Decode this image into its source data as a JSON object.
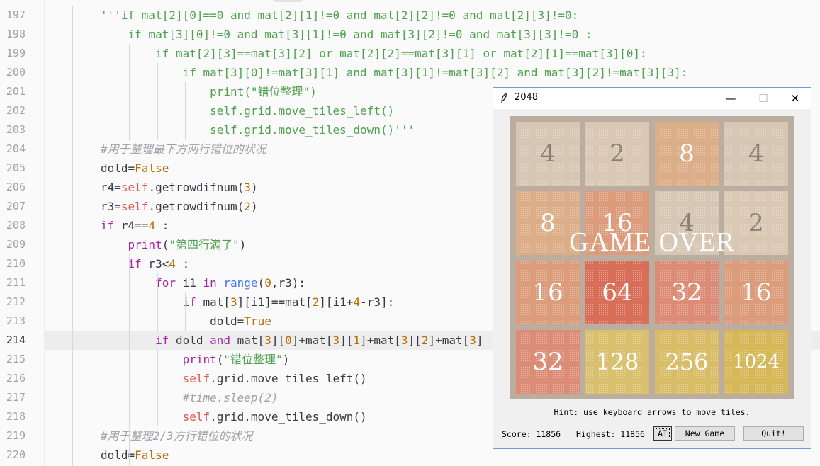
{
  "editor": {
    "current_line": "214",
    "lines": [
      {
        "no": "197",
        "tokens": [
          {
            "t": "'''if mat[2][0]==0 and mat[2][1]!=0 and mat[2][2]!=0 and mat[2][3]!=0:",
            "c": "s"
          }
        ]
      },
      {
        "no": "198",
        "tokens": [
          {
            "t": "    if mat[3][0]!=0 and mat[3][1]!=0 and mat[3][2]!=0 and mat[3][3]!=0 :",
            "c": "s"
          }
        ]
      },
      {
        "no": "199",
        "tokens": [
          {
            "t": "        if mat[2][3]==mat[3][2] or mat[2][2]==mat[3][1] or mat[2][1]==mat[3][0]:",
            "c": "s"
          }
        ]
      },
      {
        "no": "200",
        "tokens": [
          {
            "t": "            if mat[3][0]!=mat[3][1] and mat[3][1]!=mat[3][2] and mat[3][2]!=mat[3][3]:",
            "c": "s"
          }
        ]
      },
      {
        "no": "201",
        "tokens": [
          {
            "t": "                print(\"错位整理\")",
            "c": "s"
          }
        ]
      },
      {
        "no": "202",
        "tokens": [
          {
            "t": "                self.grid.move_tiles_left()",
            "c": "s"
          }
        ]
      },
      {
        "no": "203",
        "tokens": [
          {
            "t": "                self.grid.move_tiles_down()'''",
            "c": "s"
          }
        ]
      },
      {
        "no": "204",
        "tokens": [
          {
            "t": "#用于整理最下方两行错位的状况",
            "c": "c"
          }
        ]
      },
      {
        "no": "205",
        "tokens": [
          {
            "t": "dold=",
            "c": "p"
          },
          {
            "t": "False",
            "c": "n"
          }
        ]
      },
      {
        "no": "206",
        "tokens": [
          {
            "t": "r4=",
            "c": "p"
          },
          {
            "t": "self",
            "c": "sf"
          },
          {
            "t": ".getrowdifnum(",
            "c": "p"
          },
          {
            "t": "3",
            "c": "n"
          },
          {
            "t": ")",
            "c": "p"
          }
        ]
      },
      {
        "no": "207",
        "tokens": [
          {
            "t": "r3=",
            "c": "p"
          },
          {
            "t": "self",
            "c": "sf"
          },
          {
            "t": ".getrowdifnum(",
            "c": "p"
          },
          {
            "t": "2",
            "c": "n"
          },
          {
            "t": ")",
            "c": "p"
          }
        ]
      },
      {
        "no": "208",
        "tokens": [
          {
            "t": "if",
            "c": "k"
          },
          {
            "t": " r4==",
            "c": "p"
          },
          {
            "t": "4",
            "c": "n"
          },
          {
            "t": " :",
            "c": "p"
          }
        ]
      },
      {
        "no": "209",
        "tokens": [
          {
            "t": "    ",
            "c": "p"
          },
          {
            "t": "print",
            "c": "k"
          },
          {
            "t": "(",
            "c": "p"
          },
          {
            "t": "\"第四行满了\"",
            "c": "s"
          },
          {
            "t": ")",
            "c": "p"
          }
        ]
      },
      {
        "no": "210",
        "tokens": [
          {
            "t": "    ",
            "c": "p"
          },
          {
            "t": "if",
            "c": "k"
          },
          {
            "t": " r3<",
            "c": "p"
          },
          {
            "t": "4",
            "c": "n"
          },
          {
            "t": " :",
            "c": "p"
          }
        ]
      },
      {
        "no": "211",
        "tokens": [
          {
            "t": "        ",
            "c": "p"
          },
          {
            "t": "for",
            "c": "k"
          },
          {
            "t": " i1 ",
            "c": "p"
          },
          {
            "t": "in",
            "c": "k"
          },
          {
            "t": " ",
            "c": "p"
          },
          {
            "t": "range",
            "c": "b"
          },
          {
            "t": "(",
            "c": "p"
          },
          {
            "t": "0",
            "c": "n"
          },
          {
            "t": ",r3):",
            "c": "p"
          }
        ]
      },
      {
        "no": "212",
        "tokens": [
          {
            "t": "            ",
            "c": "p"
          },
          {
            "t": "if",
            "c": "k"
          },
          {
            "t": " mat[",
            "c": "p"
          },
          {
            "t": "3",
            "c": "n"
          },
          {
            "t": "][i1]==mat[",
            "c": "p"
          },
          {
            "t": "2",
            "c": "n"
          },
          {
            "t": "][i1+",
            "c": "p"
          },
          {
            "t": "4",
            "c": "n"
          },
          {
            "t": "-r3]:",
            "c": "p"
          }
        ]
      },
      {
        "no": "213",
        "tokens": [
          {
            "t": "                dold=",
            "c": "p"
          },
          {
            "t": "True",
            "c": "n"
          }
        ]
      },
      {
        "no": "214",
        "tokens": [
          {
            "t": "        ",
            "c": "p"
          },
          {
            "t": "if",
            "c": "k"
          },
          {
            "t": " dold ",
            "c": "p"
          },
          {
            "t": "and",
            "c": "k"
          },
          {
            "t": " mat[",
            "c": "p"
          },
          {
            "t": "3",
            "c": "n"
          },
          {
            "t": "][",
            "c": "p"
          },
          {
            "t": "0",
            "c": "n"
          },
          {
            "t": "]+mat[",
            "c": "p"
          },
          {
            "t": "3",
            "c": "n"
          },
          {
            "t": "][",
            "c": "p"
          },
          {
            "t": "1",
            "c": "n"
          },
          {
            "t": "]+mat[",
            "c": "p"
          },
          {
            "t": "3",
            "c": "n"
          },
          {
            "t": "][",
            "c": "p"
          },
          {
            "t": "2",
            "c": "n"
          },
          {
            "t": "]+mat[",
            "c": "p"
          },
          {
            "t": "3",
            "c": "n"
          },
          {
            "t": "]",
            "c": "p"
          }
        ]
      },
      {
        "no": "215",
        "tokens": [
          {
            "t": "            ",
            "c": "p"
          },
          {
            "t": "print",
            "c": "k"
          },
          {
            "t": "(",
            "c": "p"
          },
          {
            "t": "\"错位整理\"",
            "c": "s"
          },
          {
            "t": ")",
            "c": "p"
          }
        ]
      },
      {
        "no": "216",
        "tokens": [
          {
            "t": "            ",
            "c": "p"
          },
          {
            "t": "self",
            "c": "sf"
          },
          {
            "t": ".grid.move_tiles_left()",
            "c": "p"
          }
        ]
      },
      {
        "no": "217",
        "tokens": [
          {
            "t": "            ",
            "c": "p"
          },
          {
            "t": "#time.sleep(2)",
            "c": "c"
          }
        ]
      },
      {
        "no": "218",
        "tokens": [
          {
            "t": "            ",
            "c": "p"
          },
          {
            "t": "self",
            "c": "sf"
          },
          {
            "t": ".grid.move_tiles_down()",
            "c": "p"
          }
        ]
      },
      {
        "no": "219",
        "tokens": [
          {
            "t": "#用于整理2/3方行错位的状况",
            "c": "c"
          }
        ]
      },
      {
        "no": "220",
        "tokens": [
          {
            "t": "dold=",
            "c": "p"
          },
          {
            "t": "False",
            "c": "n"
          }
        ]
      }
    ]
  },
  "window": {
    "title": "2048",
    "minimize": "—",
    "maximize": "☐",
    "close": "✕",
    "overlay_text": "GAME  OVER",
    "hint": "Hint: use keyboard arrows to move tiles.",
    "score_label": "Score: 11856",
    "highest_label": "Highest: 11856",
    "ai_button": "AI",
    "new_game_button": "New Game",
    "quit_button": "Quit!",
    "tiles": [
      [
        "4",
        "2",
        "8",
        "4"
      ],
      [
        "8",
        "16",
        "4",
        "2"
      ],
      [
        "16",
        "64",
        "32",
        "16"
      ],
      [
        "32",
        "128",
        "256",
        "1024"
      ]
    ],
    "tile_colors": {
      "2": "#d8c8b4",
      "4": "#d6c6b3",
      "8": "#dcae88",
      "16": "#dc9c7c",
      "32": "#dc8c76",
      "64": "#d86e58",
      "128": "#d8c06e",
      "256": "#d8bc66",
      "1024": "#d6b858"
    }
  }
}
